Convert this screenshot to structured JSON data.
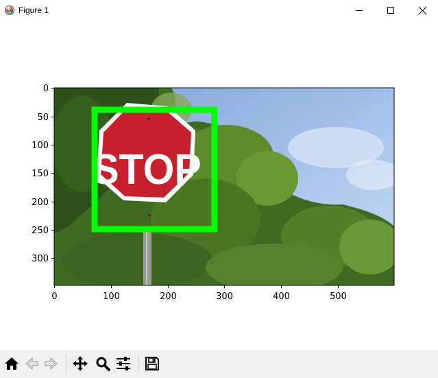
{
  "window": {
    "title": "Figure 1",
    "controls": [
      "minimize",
      "maximize",
      "close"
    ]
  },
  "figure": {
    "image": {
      "description_icon": "stop-sign-photo",
      "sign_text": "STOP",
      "bounding_box_color": "#00ff00"
    },
    "axes": {
      "x_ticks": [
        "0",
        "100",
        "200",
        "300",
        "400",
        "500"
      ],
      "y_ticks": [
        "0",
        "50",
        "100",
        "150",
        "200",
        "250",
        "300"
      ]
    }
  },
  "toolbar": {
    "buttons": [
      {
        "name": "home-button",
        "icon": "home-icon"
      },
      {
        "name": "back-button",
        "icon": "back-arrow-icon"
      },
      {
        "name": "forward-button",
        "icon": "forward-arrow-icon"
      },
      {
        "name": "pan-button",
        "icon": "move-icon"
      },
      {
        "name": "zoom-button",
        "icon": "magnifier-icon"
      },
      {
        "name": "configure-subplots-button",
        "icon": "sliders-icon"
      },
      {
        "name": "save-button",
        "icon": "floppy-disk-icon"
      }
    ]
  },
  "colors": {
    "toolbar_bg": "#f0f0f0",
    "box": "#00ff00",
    "sign_red": "#c8202c",
    "sky": "#9fbfe4"
  }
}
